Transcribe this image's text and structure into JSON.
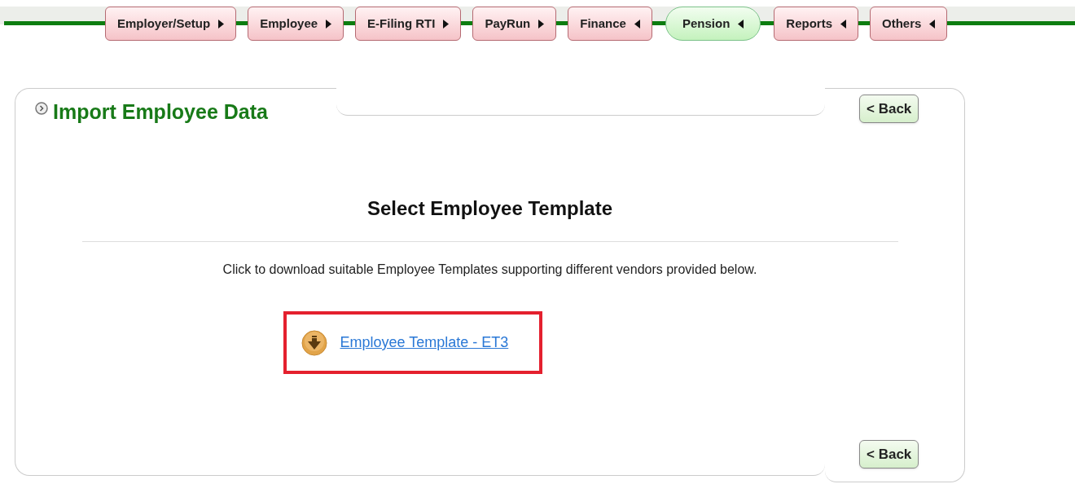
{
  "nav": {
    "tabs": [
      {
        "label": "Employer/Setup",
        "kind": "forward",
        "selected": false
      },
      {
        "label": "Employee",
        "kind": "forward",
        "selected": false
      },
      {
        "label": "E-Filing RTI",
        "kind": "forward",
        "selected": false
      },
      {
        "label": "PayRun",
        "kind": "forward",
        "selected": false
      },
      {
        "label": "Finance",
        "kind": "back",
        "selected": false
      },
      {
        "label": "Pension",
        "kind": "back",
        "selected": true
      },
      {
        "label": "Reports",
        "kind": "back",
        "selected": false
      },
      {
        "label": "Others",
        "kind": "back",
        "selected": false
      }
    ]
  },
  "panel": {
    "title": "Import Employee Data",
    "back_top": "< Back",
    "heading": "Select Employee Template",
    "description": "Click to download suitable Employee Templates supporting different vendors provided below.",
    "download_link": {
      "label": "Employee Template - ET3",
      "highlighted": true
    },
    "back_bottom": "< Back"
  }
}
